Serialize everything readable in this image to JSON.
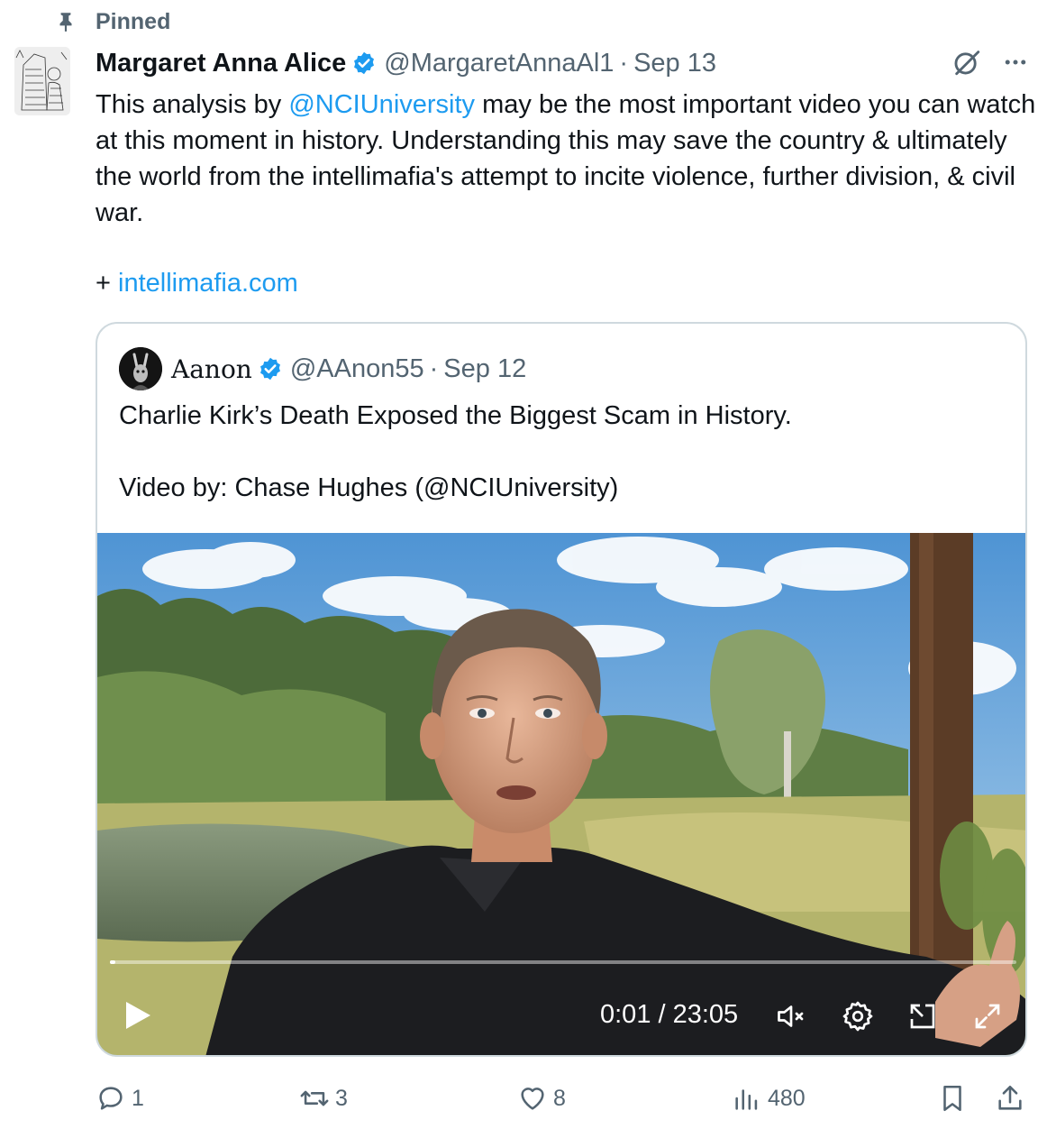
{
  "pinned": {
    "label": "Pinned",
    "icon": "pin-icon"
  },
  "tweet": {
    "author_name": "Margaret Anna Alice",
    "handle": "@MargaretAnnaAl1",
    "separator": "·",
    "date": "Sep 13",
    "text_before_mention": "This analysis by ",
    "mention": "@NCIUniversity",
    "text_after_mention": " may be the most important video you can watch at this moment in history. Understanding this may save the country & ultimately the world from the intellimafia's attempt to incite violence, further division, & civil war.",
    "link_prefix": "+ ",
    "link": "intellimafia.com"
  },
  "quote": {
    "author_name": "Aanon",
    "handle": "@AAnon55",
    "separator": "·",
    "date": "Sep 12",
    "line1": "Charlie Kirk’s Death Exposed the Biggest Scam in History.",
    "line2": "Video by: Chase Hughes (@NCIUniversity)"
  },
  "video": {
    "time": "0:01 / 23:05",
    "progress": 0.001,
    "icons": [
      "play-icon",
      "mute-icon",
      "settings-icon",
      "picture-in-picture-icon",
      "fullscreen-icon"
    ]
  },
  "actions": {
    "replies": "1",
    "reposts": "3",
    "likes": "8",
    "views": "480"
  },
  "colors": {
    "link": "#1d9bf0",
    "muted": "#536471",
    "text": "#0f1419",
    "verified": "#1d9bf0",
    "border": "#cfd9de"
  }
}
